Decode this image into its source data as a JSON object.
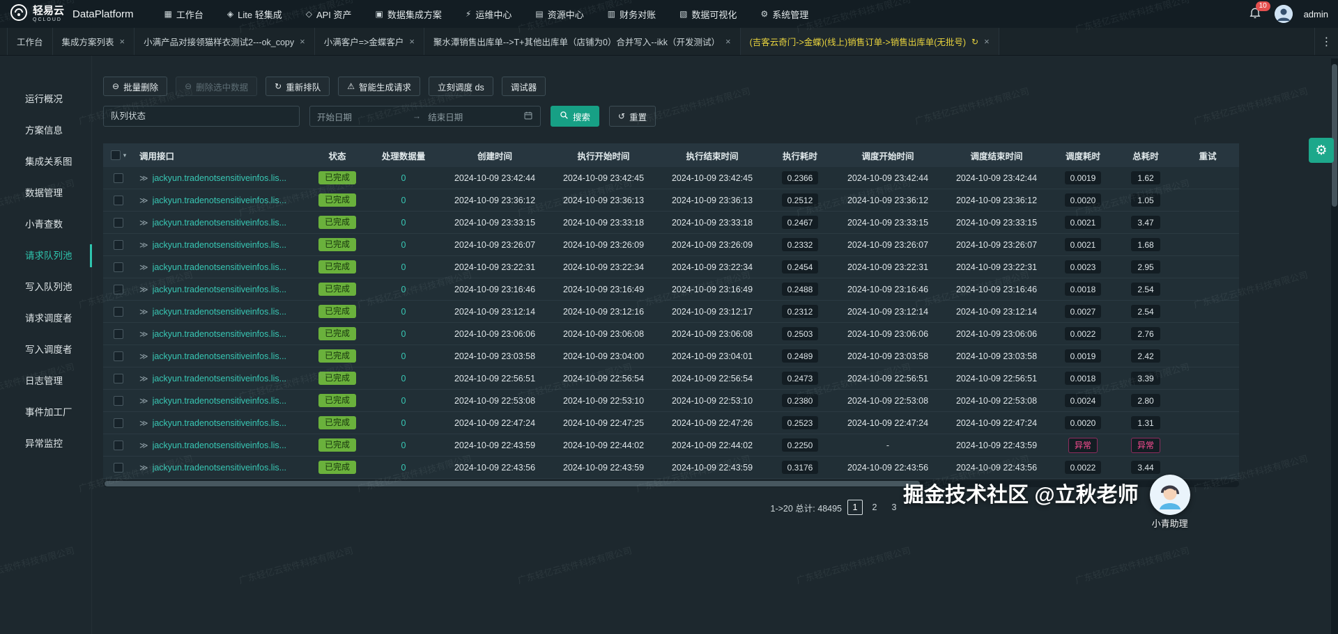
{
  "navbar": {
    "logo": "轻易云",
    "logo_sub": "QCLOUD",
    "product": "DataPlatform",
    "notification_count": "10",
    "user": "admin",
    "items": [
      {
        "label": "工作台",
        "icon": "workbench-icon"
      },
      {
        "label": "Lite 轻集成",
        "icon": "lite-icon"
      },
      {
        "label": "API 资产",
        "icon": "api-icon"
      },
      {
        "label": "数据集成方案",
        "icon": "integration-icon"
      },
      {
        "label": "运维中心",
        "icon": "ops-icon"
      },
      {
        "label": "资源中心",
        "icon": "resource-icon"
      },
      {
        "label": "财务对账",
        "icon": "finance-icon"
      },
      {
        "label": "数据可视化",
        "icon": "visualization-icon"
      },
      {
        "label": "系统管理",
        "icon": "system-icon"
      }
    ]
  },
  "tabbar": {
    "tabs": [
      {
        "label": "工作台",
        "closable": false,
        "active": false,
        "refresh": false
      },
      {
        "label": "集成方案列表",
        "closable": true,
        "active": false,
        "refresh": false
      },
      {
        "label": "小满产品对接领猫样衣测试2---ok_copy",
        "closable": true,
        "active": false,
        "refresh": false
      },
      {
        "label": "小满客户=>金蝶客户",
        "closable": true,
        "active": false,
        "refresh": false
      },
      {
        "label": "聚水潭销售出库单-->T+其他出库单（店铺为0）合并写入--ikk（开发测试）",
        "closable": true,
        "active": false,
        "refresh": false
      },
      {
        "label": "(吉客云奇门->金蝶)(线上)销售订单->销售出库单(无批号)",
        "closable": true,
        "active": true,
        "refresh": true
      }
    ]
  },
  "sidebar": {
    "active": "请求队列池",
    "items": [
      "运行概况",
      "方案信息",
      "集成关系图",
      "数据管理",
      "小青查数",
      "请求队列池",
      "写入队列池",
      "请求调度者",
      "写入调度者",
      "日志管理",
      "事件加工厂",
      "异常监控"
    ]
  },
  "toolbar": {
    "buttons": [
      {
        "label": "批量删除",
        "icon": "minus-circle-icon",
        "disabled": false
      },
      {
        "label": "删除选中数据",
        "icon": "minus-circle-icon",
        "disabled": true
      },
      {
        "label": "重新排队",
        "icon": "refresh-icon",
        "disabled": false
      },
      {
        "label": "智能生成请求",
        "icon": "warning-icon",
        "disabled": false
      },
      {
        "label": "立刻调度 ds",
        "icon": null,
        "disabled": false
      },
      {
        "label": "调试器",
        "icon": null,
        "disabled": false
      }
    ]
  },
  "filters": {
    "queue_placeholder": "队列状态",
    "start_placeholder": "开始日期",
    "end_placeholder": "结束日期",
    "search_label": "搜索",
    "reset_label": "重置"
  },
  "table": {
    "columns": [
      {
        "key": "api",
        "label": "调用接口"
      },
      {
        "key": "status",
        "label": "状态"
      },
      {
        "key": "count",
        "label": "处理数据量"
      },
      {
        "key": "created",
        "label": "创建时间"
      },
      {
        "key": "exec_start",
        "label": "执行开始时间"
      },
      {
        "key": "exec_end",
        "label": "执行结束时间"
      },
      {
        "key": "exec_time",
        "label": "执行耗时"
      },
      {
        "key": "sched_start",
        "label": "调度开始时间"
      },
      {
        "key": "sched_end",
        "label": "调度结束时间"
      },
      {
        "key": "sched_time",
        "label": "调度耗时"
      },
      {
        "key": "total_time",
        "label": "总耗时"
      },
      {
        "key": "retry",
        "label": "重试"
      }
    ],
    "rows": [
      {
        "api": "jackyun.tradenotsensitiveinfos.lis...",
        "status": "已完成",
        "count": "0",
        "created": "2024-10-09 23:42:44",
        "exec_start": "2024-10-09 23:42:45",
        "exec_end": "2024-10-09 23:42:45",
        "exec_time": "0.2366",
        "sched_start": "2024-10-09 23:42:44",
        "sched_end": "2024-10-09 23:42:44",
        "sched_time": "0.0019",
        "total_time": "1.62",
        "retry": ""
      },
      {
        "api": "jackyun.tradenotsensitiveinfos.lis...",
        "status": "已完成",
        "count": "0",
        "created": "2024-10-09 23:36:12",
        "exec_start": "2024-10-09 23:36:13",
        "exec_end": "2024-10-09 23:36:13",
        "exec_time": "0.2512",
        "sched_start": "2024-10-09 23:36:12",
        "sched_end": "2024-10-09 23:36:12",
        "sched_time": "0.0020",
        "total_time": "1.05",
        "retry": ""
      },
      {
        "api": "jackyun.tradenotsensitiveinfos.lis...",
        "status": "已完成",
        "count": "0",
        "created": "2024-10-09 23:33:15",
        "exec_start": "2024-10-09 23:33:18",
        "exec_end": "2024-10-09 23:33:18",
        "exec_time": "0.2467",
        "sched_start": "2024-10-09 23:33:15",
        "sched_end": "2024-10-09 23:33:15",
        "sched_time": "0.0021",
        "total_time": "3.47",
        "retry": ""
      },
      {
        "api": "jackyun.tradenotsensitiveinfos.lis...",
        "status": "已完成",
        "count": "0",
        "created": "2024-10-09 23:26:07",
        "exec_start": "2024-10-09 23:26:09",
        "exec_end": "2024-10-09 23:26:09",
        "exec_time": "0.2332",
        "sched_start": "2024-10-09 23:26:07",
        "sched_end": "2024-10-09 23:26:07",
        "sched_time": "0.0021",
        "total_time": "1.68",
        "retry": ""
      },
      {
        "api": "jackyun.tradenotsensitiveinfos.lis...",
        "status": "已完成",
        "count": "0",
        "created": "2024-10-09 23:22:31",
        "exec_start": "2024-10-09 23:22:34",
        "exec_end": "2024-10-09 23:22:34",
        "exec_time": "0.2454",
        "sched_start": "2024-10-09 23:22:31",
        "sched_end": "2024-10-09 23:22:31",
        "sched_time": "0.0023",
        "total_time": "2.95",
        "retry": ""
      },
      {
        "api": "jackyun.tradenotsensitiveinfos.lis...",
        "status": "已完成",
        "count": "0",
        "created": "2024-10-09 23:16:46",
        "exec_start": "2024-10-09 23:16:49",
        "exec_end": "2024-10-09 23:16:49",
        "exec_time": "0.2488",
        "sched_start": "2024-10-09 23:16:46",
        "sched_end": "2024-10-09 23:16:46",
        "sched_time": "0.0018",
        "total_time": "2.54",
        "retry": ""
      },
      {
        "api": "jackyun.tradenotsensitiveinfos.lis...",
        "status": "已完成",
        "count": "0",
        "created": "2024-10-09 23:12:14",
        "exec_start": "2024-10-09 23:12:16",
        "exec_end": "2024-10-09 23:12:17",
        "exec_time": "0.2312",
        "sched_start": "2024-10-09 23:12:14",
        "sched_end": "2024-10-09 23:12:14",
        "sched_time": "0.0027",
        "total_time": "2.54",
        "retry": ""
      },
      {
        "api": "jackyun.tradenotsensitiveinfos.lis...",
        "status": "已完成",
        "count": "0",
        "created": "2024-10-09 23:06:06",
        "exec_start": "2024-10-09 23:06:08",
        "exec_end": "2024-10-09 23:06:08",
        "exec_time": "0.2503",
        "sched_start": "2024-10-09 23:06:06",
        "sched_end": "2024-10-09 23:06:06",
        "sched_time": "0.0022",
        "total_time": "2.76",
        "retry": ""
      },
      {
        "api": "jackyun.tradenotsensitiveinfos.lis...",
        "status": "已完成",
        "count": "0",
        "created": "2024-10-09 23:03:58",
        "exec_start": "2024-10-09 23:04:00",
        "exec_end": "2024-10-09 23:04:01",
        "exec_time": "0.2489",
        "sched_start": "2024-10-09 23:03:58",
        "sched_end": "2024-10-09 23:03:58",
        "sched_time": "0.0019",
        "total_time": "2.42",
        "retry": ""
      },
      {
        "api": "jackyun.tradenotsensitiveinfos.lis...",
        "status": "已完成",
        "count": "0",
        "created": "2024-10-09 22:56:51",
        "exec_start": "2024-10-09 22:56:54",
        "exec_end": "2024-10-09 22:56:54",
        "exec_time": "0.2473",
        "sched_start": "2024-10-09 22:56:51",
        "sched_end": "2024-10-09 22:56:51",
        "sched_time": "0.0018",
        "total_time": "3.39",
        "retry": ""
      },
      {
        "api": "jackyun.tradenotsensitiveinfos.lis...",
        "status": "已完成",
        "count": "0",
        "created": "2024-10-09 22:53:08",
        "exec_start": "2024-10-09 22:53:10",
        "exec_end": "2024-10-09 22:53:10",
        "exec_time": "0.2380",
        "sched_start": "2024-10-09 22:53:08",
        "sched_end": "2024-10-09 22:53:08",
        "sched_time": "0.0024",
        "total_time": "2.80",
        "retry": ""
      },
      {
        "api": "jackyun.tradenotsensitiveinfos.lis...",
        "status": "已完成",
        "count": "0",
        "created": "2024-10-09 22:47:24",
        "exec_start": "2024-10-09 22:47:25",
        "exec_end": "2024-10-09 22:47:26",
        "exec_time": "0.2523",
        "sched_start": "2024-10-09 22:47:24",
        "sched_end": "2024-10-09 22:47:24",
        "sched_time": "0.0020",
        "total_time": "1.31",
        "retry": ""
      },
      {
        "api": "jackyun.tradenotsensitiveinfos.lis...",
        "status": "已完成",
        "count": "0",
        "created": "2024-10-09 22:43:59",
        "exec_start": "2024-10-09 22:44:02",
        "exec_end": "2024-10-09 22:44:02",
        "exec_time": "0.2250",
        "sched_start": "-",
        "sched_end": "2024-10-09 22:43:59",
        "sched_time": "异常",
        "total_time": "异常",
        "retry": ""
      },
      {
        "api": "jackyun.tradenotsensitiveinfos.lis...",
        "status": "已完成",
        "count": "0",
        "created": "2024-10-09 22:43:56",
        "exec_start": "2024-10-09 22:43:59",
        "exec_end": "2024-10-09 22:43:59",
        "exec_time": "0.3176",
        "sched_start": "2024-10-09 22:43:56",
        "sched_end": "2024-10-09 22:43:56",
        "sched_time": "0.0022",
        "total_time": "3.44",
        "retry": ""
      }
    ]
  },
  "pagination": {
    "total_text": "1->20 总计: 48495",
    "pages": [
      "1",
      "2",
      "3"
    ],
    "active": "1"
  },
  "watermark": {
    "text": "广东轻亿云软件科技有限公司"
  },
  "overlay": {
    "credit": "掘金技术社区 @立秋老师",
    "assistant": "小青助理"
  }
}
